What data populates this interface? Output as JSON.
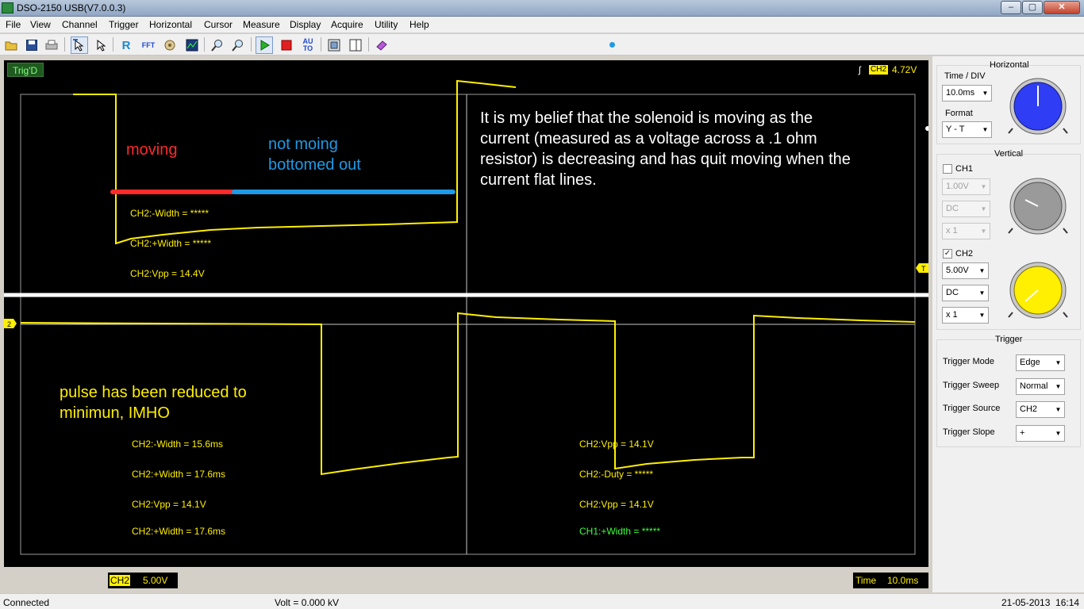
{
  "window": {
    "title": "DSO-2150 USB(V7.0.0.3)"
  },
  "menu": [
    "File",
    "View",
    "Channel",
    "Trigger",
    "Horizontal",
    "Cursor",
    "Measure",
    "Display",
    "Acquire",
    "Utility",
    "Help"
  ],
  "toolbar": {
    "icons": [
      "open-icon",
      "save-icon",
      "print-icon",
      "select-icon",
      "pointer-icon",
      "reference-icon",
      "fft-icon",
      "math-icon",
      "display-icon",
      "zoom-in-icon",
      "zoom-out-icon",
      "run-icon",
      "stop-icon",
      "autoset-icon",
      "screenshot-icon",
      "export-icon",
      "book-icon"
    ],
    "autoset_label": "AU TO",
    "fft_label": "FFT",
    "ref_label": "R"
  },
  "scope": {
    "trig_status": "Trig'D",
    "trigger_channel": "CH2",
    "trigger_level": "4.72V",
    "ch2_marker": "2",
    "trigger_marker": "T",
    "ch2_scale_label": "CH2",
    "ch2_scale_value": "5.00V",
    "time_label": "Time",
    "time_value": "10.0ms"
  },
  "annotations": {
    "moving": "moving",
    "not_moving_1": "not moing",
    "not_moving_2": "bottomed out",
    "belief_1": "It is my belief that the solenoid is moving as the",
    "belief_2": "current (measured as a voltage across a .1 ohm",
    "belief_3": "resistor) is decreasing and has quit moving when the",
    "belief_4": "current flat lines.",
    "pulse_1": "pulse has been reduced to",
    "pulse_2": "minimun, IMHO"
  },
  "measurements": {
    "top": [
      "CH2:-Width = *****",
      "CH2:+Width = *****",
      "CH2:Vpp = 14.4V"
    ],
    "bottom_left": [
      "CH2:-Width = 15.6ms",
      "CH2:+Width = 17.6ms",
      "CH2:Vpp = 14.1V",
      "CH2:+Width = 17.6ms"
    ],
    "bottom_right": [
      "CH2:Vpp = 14.1V",
      "CH2:-Duty = *****",
      "CH2:Vpp = 14.1V",
      "CH1:+Width = *****"
    ]
  },
  "panel": {
    "horizontal": {
      "title": "Horizontal",
      "time_div_label": "Time / DIV",
      "time_div_value": "10.0ms",
      "format_label": "Format",
      "format_value": "Y - T"
    },
    "vertical": {
      "title": "Vertical",
      "ch1_label": "CH1",
      "ch1_checked": false,
      "ch1_volt": "1.00V",
      "ch1_coupling": "DC",
      "ch1_probe": "x 1",
      "ch2_label": "CH2",
      "ch2_checked": true,
      "ch2_volt": "5.00V",
      "ch2_coupling": "DC",
      "ch2_probe": "x 1"
    },
    "trigger": {
      "title": "Trigger",
      "mode_label": "Trigger Mode",
      "mode_value": "Edge",
      "sweep_label": "Trigger Sweep",
      "sweep_value": "Normal",
      "source_label": "Trigger Source",
      "source_value": "CH2",
      "slope_label": "Trigger Slope",
      "slope_value": "+"
    }
  },
  "colors": {
    "trace": "#ffef00",
    "moving": "#ff2a2a",
    "not_moving": "#1e9ae6",
    "knob_horizontal": "#2f3df5",
    "knob_ch1": "#9a9a9a",
    "knob_ch2": "#ffef00"
  },
  "status": {
    "connection": "Connected",
    "volt": "Volt = 0.000 kV",
    "datetime": "21-05-2013  16:14"
  }
}
